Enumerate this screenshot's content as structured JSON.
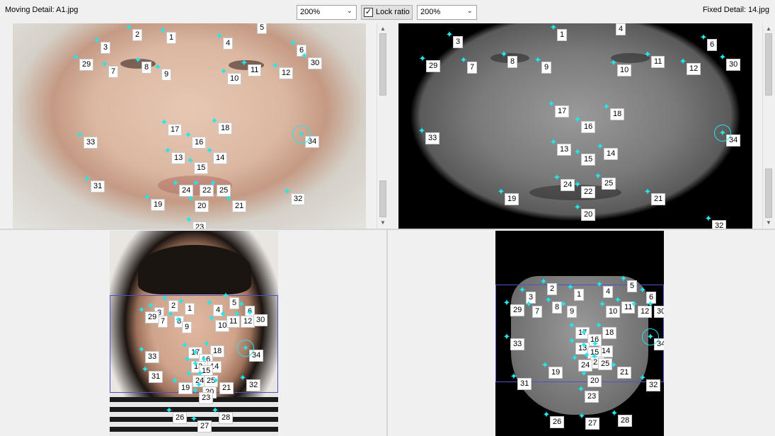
{
  "header": {
    "moving_label": "Moving Detail: A1.jpg",
    "fixed_label": "Fixed Detail: 14.jpg",
    "zoom_left": "200%",
    "zoom_right": "200%",
    "lock_label": "Lock ratio",
    "lock_checked": "✓"
  },
  "colors": {
    "landmark": "#20e6ee",
    "roi": "#5050c8"
  },
  "moving_detail": [
    {
      "id": "2"
    },
    {
      "id": "1"
    },
    {
      "id": "5"
    },
    {
      "id": "3"
    },
    {
      "id": "4"
    },
    {
      "id": "6"
    },
    {
      "id": "29"
    },
    {
      "id": "7"
    },
    {
      "id": "8"
    },
    {
      "id": "9"
    },
    {
      "id": "10"
    },
    {
      "id": "11"
    },
    {
      "id": "12"
    },
    {
      "id": "30"
    },
    {
      "id": "17"
    },
    {
      "id": "18"
    },
    {
      "id": "16"
    },
    {
      "id": "33"
    },
    {
      "id": "34"
    },
    {
      "id": "13"
    },
    {
      "id": "14"
    },
    {
      "id": "15"
    },
    {
      "id": "31"
    },
    {
      "id": "24"
    },
    {
      "id": "22"
    },
    {
      "id": "25"
    },
    {
      "id": "32"
    },
    {
      "id": "19"
    },
    {
      "id": "20"
    },
    {
      "id": "21"
    },
    {
      "id": "23"
    }
  ],
  "fixed_detail": [
    {
      "id": "1"
    },
    {
      "id": "4"
    },
    {
      "id": "3"
    },
    {
      "id": "6"
    },
    {
      "id": "29"
    },
    {
      "id": "7"
    },
    {
      "id": "8"
    },
    {
      "id": "9"
    },
    {
      "id": "10"
    },
    {
      "id": "11"
    },
    {
      "id": "12"
    },
    {
      "id": "30"
    },
    {
      "id": "17"
    },
    {
      "id": "18"
    },
    {
      "id": "16"
    },
    {
      "id": "33"
    },
    {
      "id": "34"
    },
    {
      "id": "13"
    },
    {
      "id": "14"
    },
    {
      "id": "15"
    },
    {
      "id": "24"
    },
    {
      "id": "22"
    },
    {
      "id": "25"
    },
    {
      "id": "19"
    },
    {
      "id": "21"
    },
    {
      "id": "20"
    },
    {
      "id": "32"
    }
  ],
  "moving_overview": [
    {
      "id": "2"
    },
    {
      "id": "1"
    },
    {
      "id": "3"
    },
    {
      "id": "7"
    },
    {
      "id": "29"
    },
    {
      "id": "8"
    },
    {
      "id": "9"
    },
    {
      "id": "4"
    },
    {
      "id": "5"
    },
    {
      "id": "6"
    },
    {
      "id": "10"
    },
    {
      "id": "11"
    },
    {
      "id": "12"
    },
    {
      "id": "30"
    },
    {
      "id": "17"
    },
    {
      "id": "18"
    },
    {
      "id": "16"
    },
    {
      "id": "33"
    },
    {
      "id": "34"
    },
    {
      "id": "13"
    },
    {
      "id": "14"
    },
    {
      "id": "15"
    },
    {
      "id": "31"
    },
    {
      "id": "24"
    },
    {
      "id": "25"
    },
    {
      "id": "19"
    },
    {
      "id": "20"
    },
    {
      "id": "21"
    },
    {
      "id": "32"
    },
    {
      "id": "23"
    },
    {
      "id": "26"
    },
    {
      "id": "27"
    },
    {
      "id": "28"
    }
  ],
  "fixed_overview": [
    {
      "id": "2"
    },
    {
      "id": "1"
    },
    {
      "id": "4"
    },
    {
      "id": "5"
    },
    {
      "id": "3"
    },
    {
      "id": "6"
    },
    {
      "id": "29"
    },
    {
      "id": "7"
    },
    {
      "id": "8"
    },
    {
      "id": "9"
    },
    {
      "id": "10"
    },
    {
      "id": "11"
    },
    {
      "id": "12"
    },
    {
      "id": "30"
    },
    {
      "id": "17"
    },
    {
      "id": "18"
    },
    {
      "id": "16"
    },
    {
      "id": "33"
    },
    {
      "id": "34"
    },
    {
      "id": "13"
    },
    {
      "id": "14"
    },
    {
      "id": "15"
    },
    {
      "id": "22"
    },
    {
      "id": "24"
    },
    {
      "id": "25"
    },
    {
      "id": "19"
    },
    {
      "id": "21"
    },
    {
      "id": "20"
    },
    {
      "id": "32"
    },
    {
      "id": "31"
    },
    {
      "id": "23"
    },
    {
      "id": "26"
    },
    {
      "id": "27"
    },
    {
      "id": "28"
    }
  ]
}
